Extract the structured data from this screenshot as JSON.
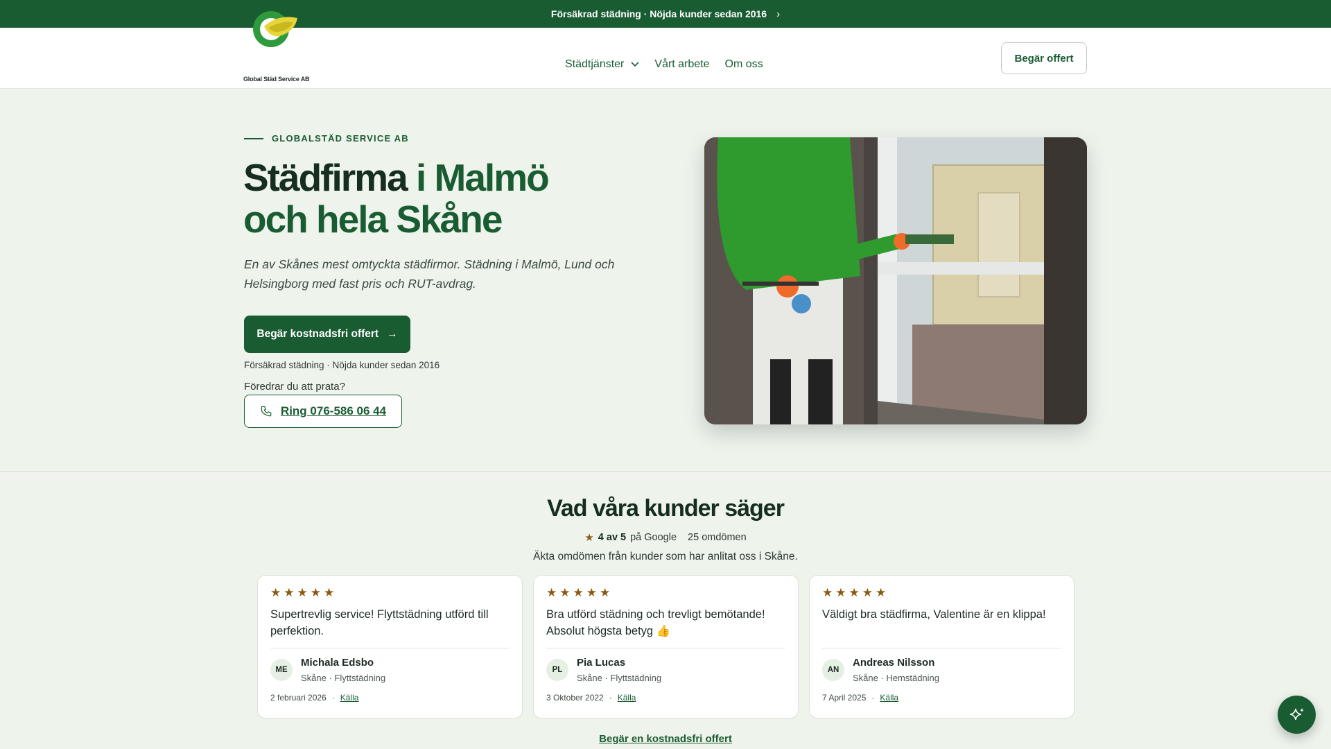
{
  "announcement": {
    "text": "Försäkrad städning · Nöjda kunder sedan 2016",
    "chevron": "›"
  },
  "header": {
    "logo_text": "Global Städ Service AB",
    "nav": [
      {
        "label": "Städtjänster",
        "icon": "chevron-down-icon"
      },
      {
        "label": "Vårt arbete"
      },
      {
        "label": "Om oss"
      }
    ],
    "quote_button": "Begär offert"
  },
  "hero": {
    "eyebrow": "GLOBALSTÄD SERVICE AB",
    "title_part1": "Städfirma ",
    "title_part2": "i Malmö",
    "title_part3": "och hela Skåne",
    "lead": "En av Skånes mest omtyckta städfirmor. Städning i Malmö, Lund och Helsingborg med fast pris och RUT-avdrag.",
    "cta_label": "Begär kostnadsfri offert",
    "cta_arrow": "→",
    "trust_line": "Försäkrad städning · Nöjda kunder sedan 2016",
    "prefer_talk": "Föredrar du att prata?",
    "call_label": "Ring 076-586 06 44"
  },
  "reviews": {
    "title": "Vad våra kunder säger",
    "rating_star": "★",
    "rating_value": "4 av 5",
    "rating_source": "på Google",
    "rating_count": "25 omdömen",
    "subtitle": "Äkta omdömen från kunder som har anlitat oss i Skåne.",
    "cards": [
      {
        "stars": "★★★★★",
        "text": "Supertrevlig service! Flyttstädning utförd till perfektion.",
        "initials": "ME",
        "name": "Michala Edsbo",
        "meta": "Skåne · Flyttstädning",
        "date": "2 februari 2026",
        "dot": "·",
        "source": "Källa"
      },
      {
        "stars": "★★★★★",
        "text": "Bra utförd städning och trevligt bemötande! Absolut högsta betyg 👍",
        "initials": "PL",
        "name": "Pia Lucas",
        "meta": "Skåne · Flyttstädning",
        "date": "3 Oktober 2022",
        "dot": "·",
        "source": "Källa"
      },
      {
        "stars": "★★★★★",
        "text": "Väldigt bra städfirma, Valentine är en klippa!",
        "initials": "AN",
        "name": "Andreas Nilsson",
        "meta": "Skåne · Hemstädning",
        "date": "7 April 2025",
        "dot": "·",
        "source": "Källa"
      }
    ],
    "bottom_link": "Begär en kostnadsfri offert"
  },
  "colors": {
    "brand_green": "#1a5c32",
    "star": "#8a5a12",
    "background": "#eef3ec"
  },
  "fab": {
    "icon": "sparkle-icon"
  }
}
